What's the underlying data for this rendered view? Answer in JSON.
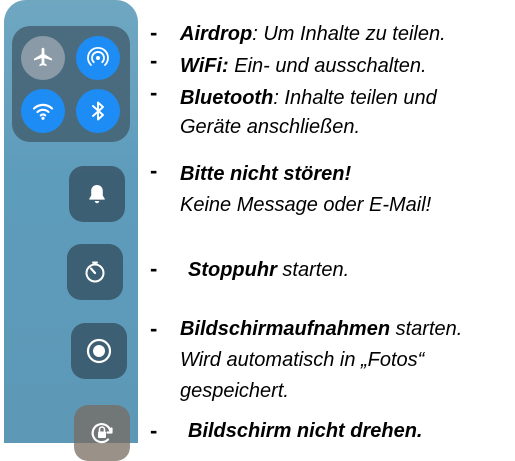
{
  "control_center": {
    "tiles": [
      {
        "name": "airplane-mode",
        "icon": "airplane-icon",
        "state": "off"
      },
      {
        "name": "airdrop",
        "icon": "airdrop-icon",
        "state": "on"
      },
      {
        "name": "wifi",
        "icon": "wifi-icon",
        "state": "on"
      },
      {
        "name": "bluetooth",
        "icon": "bluetooth-icon",
        "state": "on"
      },
      {
        "name": "do-not-disturb",
        "icon": "bell-icon"
      },
      {
        "name": "stopwatch",
        "icon": "stopwatch-icon"
      },
      {
        "name": "screen-recording",
        "icon": "record-icon"
      },
      {
        "name": "orientation-lock",
        "icon": "rotation-lock-icon"
      }
    ],
    "colors": {
      "panel": "#5e9cbc",
      "active_blue": "#1e8cf5",
      "inactive_gray": "#8a9aa6",
      "tile_dark": "#344e60"
    }
  },
  "notes": {
    "dash": "-",
    "airdrop": {
      "term": "Airdrop",
      "rest": ": Um Inhalte zu teilen."
    },
    "wifi": {
      "term": "WiFi:",
      "rest": " Ein- und ausschalten."
    },
    "bluetooth": {
      "term": "Bluetooth",
      "rest": ": Inhalte teilen und",
      "line2": "Geräte anschließen."
    },
    "dnd": {
      "term": "Bitte nicht stören!",
      "line2": "Keine Message oder E-Mail!"
    },
    "stopwatch": {
      "term": "Stoppuhr",
      "rest": " starten."
    },
    "recording": {
      "term": "Bildschirmaufnahmen",
      "rest": " starten.",
      "line2": "Wird automatisch in „Fotos“",
      "line3": "gespeichert."
    },
    "rotation": {
      "term": "Bildschirm nicht drehen."
    }
  }
}
